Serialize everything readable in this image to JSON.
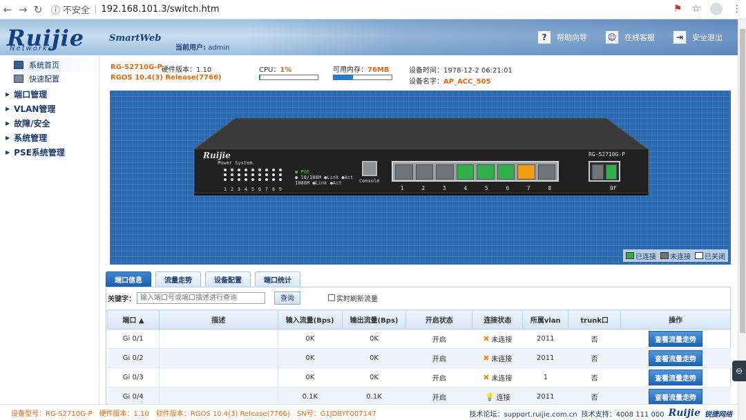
{
  "browser": {
    "security": "不安全",
    "url": "192.168.101.3/switch.htm"
  },
  "header": {
    "logo": "Ruijie",
    "logo_sub": "Networks",
    "product": "SmartWeb",
    "current_user_label": "当前用户:",
    "current_user": "admin",
    "links": [
      {
        "label": "帮助向导",
        "icon": "help-icon",
        "glyph": "?"
      },
      {
        "label": "在线客服",
        "icon": "customer-service-icon",
        "glyph": "☺"
      },
      {
        "label": "安全退出",
        "icon": "logout-icon",
        "glyph": "⇥"
      }
    ]
  },
  "sidebar": {
    "top_items": [
      {
        "label": "系统首页",
        "icon": "home-icon"
      },
      {
        "label": "快速配置",
        "icon": "quick-config-icon"
      }
    ],
    "menu": [
      {
        "label": "端口管理"
      },
      {
        "label": "VLAN管理"
      },
      {
        "label": "故障/安全"
      },
      {
        "label": "系统管理"
      },
      {
        "label": "PSE系统管理"
      }
    ]
  },
  "device": {
    "model": "RG-S2710G-P",
    "hw_version": "硬件版本：1.10",
    "rgos": "RGOS 10.4(3) Release(7766)",
    "cpu_label": "CPU：",
    "cpu": "1%",
    "cpu_fraction": 0.01,
    "mem_label": "可用内存：",
    "mem": "76MB",
    "mem_fraction": 0.33,
    "time": "设备时间：1978-12-2 06:21:01",
    "name_label": "设备名字：",
    "name": "AP_ACC_505"
  },
  "panel": {
    "logo": "Ruijie",
    "power_system": "Power System",
    "led_numbers": [
      "1",
      "2",
      "3",
      "4",
      "5",
      "6",
      "7",
      "8",
      "9"
    ],
    "legend_lines": [
      "● POE",
      "● 10/100M ●Link ●Act",
      "  1000M ●Link ●Act"
    ],
    "console": "Console",
    "model": "RG-S2710G-P",
    "port_numbers": [
      "1",
      "2",
      "3",
      "4",
      "5",
      "6",
      "7",
      "8"
    ],
    "port_states": [
      "down",
      "down",
      "down",
      "up",
      "up",
      "up",
      "off",
      "down"
    ],
    "sfp_port": "9F",
    "sfp_state": "up",
    "legend": [
      {
        "label": "已连接",
        "color": "#31b04a"
      },
      {
        "label": "未连接",
        "color": "#6f7479"
      },
      {
        "label": "已关闭",
        "color": "#ffffff"
      }
    ]
  },
  "tabs": [
    {
      "label": "端口信息",
      "active": true
    },
    {
      "label": "流量走势",
      "active": false
    },
    {
      "label": "设备配置",
      "active": false
    },
    {
      "label": "端口统计",
      "active": false
    }
  ],
  "search": {
    "label": "关键字：",
    "placeholder": "输入端口号或端口描述进行查询",
    "button": "查询",
    "realtime": "实时刷新流量"
  },
  "table": {
    "headers": [
      "端口 ▲",
      "描述",
      "输入流量(Bps)",
      "输出流量(Bps)",
      "开启状态",
      "连接状态",
      "所属vlan",
      "trunk口",
      "操作"
    ],
    "rows": [
      {
        "port": "Gi 0/1",
        "desc": "",
        "in": "0K",
        "out": "0K",
        "enable": "开启",
        "link": "未连接",
        "vlan": "2011",
        "trunk": "否",
        "action": "查看流量走势"
      },
      {
        "port": "Gi 0/2",
        "desc": "",
        "in": "0K",
        "out": "0K",
        "enable": "开启",
        "link": "未连接",
        "vlan": "2011",
        "trunk": "否",
        "action": "查看流量走势"
      },
      {
        "port": "Gi 0/3",
        "desc": "",
        "in": "0K",
        "out": "0K",
        "enable": "开启",
        "link": "未连接",
        "vlan": "1",
        "trunk": "否",
        "action": "查看流量走势"
      },
      {
        "port": "Gi 0/4",
        "desc": "",
        "in": "0.1K",
        "out": "0.1K",
        "enable": "开启",
        "link": "连接",
        "vlan": "2011",
        "trunk": "否",
        "action": "查看流量走势"
      }
    ]
  },
  "footer": {
    "model": "设备型号：RG-S2710G-P",
    "hw": "硬件版本：1.10",
    "sw": "软件版本：RGOS 10.4(3) Release(7766)",
    "sn": "SN号：G1JDBYF007147",
    "forum": "技术论坛：support.ruijie.com.cn",
    "support": "技术支持：4008 111 000",
    "brand": "Ruijie",
    "brand_cn": "锐捷网络"
  }
}
